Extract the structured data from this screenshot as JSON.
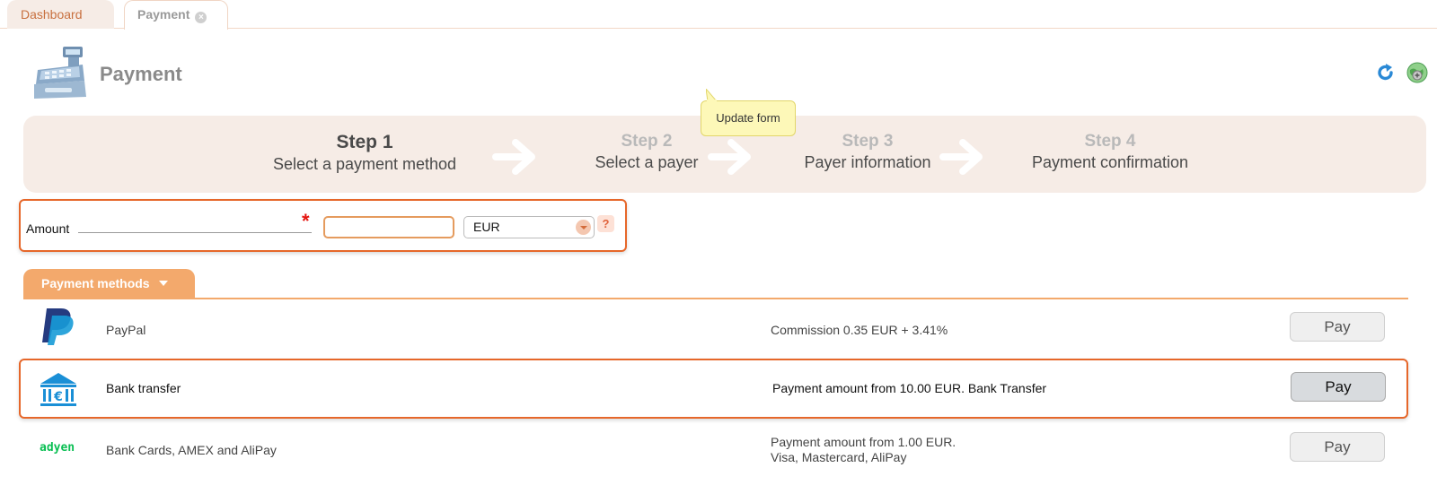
{
  "tabs": [
    {
      "label": "Dashboard"
    },
    {
      "label": "Payment"
    }
  ],
  "header": {
    "title": "Payment"
  },
  "tooltip": {
    "text": "Update form"
  },
  "steps": [
    {
      "number": "Step 1",
      "label": "Select a payment method",
      "active": true
    },
    {
      "number": "Step 2",
      "label": "Select a payer",
      "active": false
    },
    {
      "number": "Step 3",
      "label": "Payer information",
      "active": false
    },
    {
      "number": "Step 4",
      "label": "Payment confirmation",
      "active": false
    }
  ],
  "amount": {
    "label": "Amount",
    "required_mark": "*",
    "value": "",
    "currency": "EUR",
    "help": "?"
  },
  "payment_methods": {
    "header": "Payment methods",
    "items": [
      {
        "icon": "paypal-icon",
        "name": "PayPal",
        "commission_line1": "Commission 0.35 EUR + 3.41%",
        "commission_line2": "",
        "pay_label": "Pay"
      },
      {
        "icon": "bank-transfer-icon",
        "name": "Bank transfer",
        "commission_line1": "Payment amount from 10.00 EUR. Bank Transfer",
        "commission_line2": "",
        "pay_label": "Pay"
      },
      {
        "icon": "adyen-logo",
        "logo_text": "adyen",
        "name": "Bank Cards, AMEX and AliPay",
        "commission_line1": "Payment amount from 1.00 EUR.",
        "commission_line2": "Visa, Mastercard, AliPay",
        "pay_label": "Pay"
      }
    ]
  },
  "colors": {
    "accent_orange": "#e6672a",
    "tab_orange": "#f3a96c",
    "steps_bg": "#f6ece6",
    "paypal_dark": "#253b80",
    "paypal_light": "#179bd7",
    "bank_blue": "#1a8fd6",
    "adyen_green": "#0abf53"
  }
}
